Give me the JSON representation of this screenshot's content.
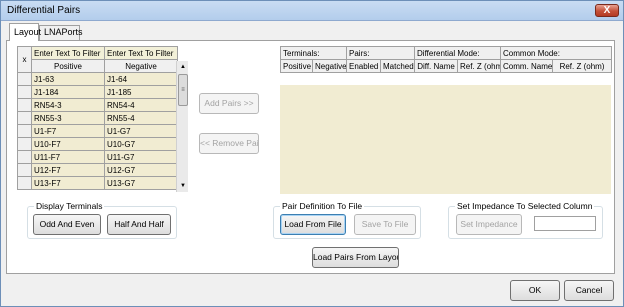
{
  "window": {
    "title": "Differential Pairs",
    "close_symbol": "X"
  },
  "tabs": [
    {
      "label": "Layout"
    },
    {
      "label": "LNAPorts"
    }
  ],
  "left_grid": {
    "corner_label": "x",
    "filters": [
      "Enter Text To Filter",
      "Enter Text To Filter"
    ],
    "headers": [
      "Positive",
      "Negative"
    ],
    "rows": [
      [
        "J1-63",
        "J1-64"
      ],
      [
        "J1-184",
        "J1-185"
      ],
      [
        "RN54-3",
        "RN54-4"
      ],
      [
        "RN55-3",
        "RN55-4"
      ],
      [
        "U1-F7",
        "U1-G7"
      ],
      [
        "U10-F7",
        "U10-G7"
      ],
      [
        "U11-F7",
        "U11-G7"
      ],
      [
        "U12-F7",
        "U12-G7"
      ],
      [
        "U13-F7",
        "U13-G7"
      ]
    ]
  },
  "scrollbar": {
    "up": "▲",
    "down": "▼",
    "grip": "≡"
  },
  "middle_buttons": {
    "add_pairs": "Add Pairs >>",
    "remove_pairs": "<< Remove Pairs"
  },
  "right_grid": {
    "summary": [
      "Terminals:",
      "Pairs:",
      "Differential Mode:",
      "Common Mode:"
    ],
    "headers": [
      "Positive",
      "Negative",
      "Enabled",
      "Matched",
      "Diff. Name",
      "Ref. Z (ohm)",
      "Comm. Name",
      "Ref. Z (ohm)"
    ]
  },
  "display_terminals": {
    "title": "Display Terminals",
    "odd_even": "Odd And Even",
    "half_half": "Half And Half"
  },
  "pair_definition": {
    "title": "Pair Definition To File",
    "load": "Load From File",
    "save": "Save To File"
  },
  "set_impedance": {
    "title": "Set Impedance To Selected Column",
    "button": "Set Impedance",
    "value": ""
  },
  "load_pairs_layout": "Load Pairs From Layout",
  "footer": {
    "ok": "OK",
    "cancel": "Cancel"
  }
}
